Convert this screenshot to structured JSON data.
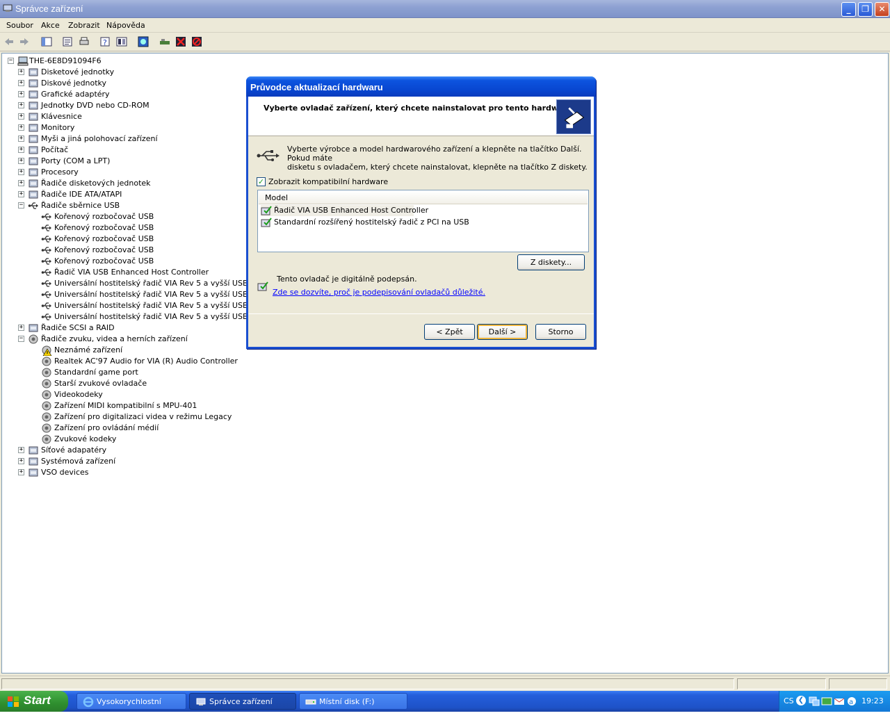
{
  "window": {
    "title": "Správce zařízení"
  },
  "menu": [
    "Soubor",
    "Akce",
    "Zobrazit",
    "Nápověda"
  ],
  "toolbar_icons": [
    "back-icon",
    "forward-icon",
    "show-hide-tree-icon",
    "properties-icon",
    "print-icon",
    "help-icon",
    "view-icon",
    "scan-hardware-icon",
    "update-driver-icon",
    "uninstall-icon",
    "disable-icon"
  ],
  "tree": {
    "root": "THE-6E8D91094F6",
    "items": [
      {
        "label": "Disketové jednotky",
        "icon": "floppy-drive-icon",
        "expander": "+",
        "level": 1
      },
      {
        "label": "Diskové jednotky",
        "icon": "disk-drive-icon",
        "expander": "+",
        "level": 1
      },
      {
        "label": "Grafické adaptéry",
        "icon": "display-adapter-icon",
        "expander": "+",
        "level": 1
      },
      {
        "label": "Jednotky DVD nebo CD-ROM",
        "icon": "cdrom-icon",
        "expander": "+",
        "level": 1
      },
      {
        "label": "Klávesnice",
        "icon": "keyboard-icon",
        "expander": "+",
        "level": 1
      },
      {
        "label": "Monitory",
        "icon": "monitor-icon",
        "expander": "+",
        "level": 1
      },
      {
        "label": "Myši a jiná polohovací zařízení",
        "icon": "mouse-icon",
        "expander": "+",
        "level": 1
      },
      {
        "label": "Počítač",
        "icon": "computer-icon",
        "expander": "+",
        "level": 1
      },
      {
        "label": "Porty (COM a LPT)",
        "icon": "port-icon",
        "expander": "+",
        "level": 1
      },
      {
        "label": "Procesory",
        "icon": "processor-icon",
        "expander": "+",
        "level": 1
      },
      {
        "label": "Řadiče disketových jednotek",
        "icon": "floppy-controller-icon",
        "expander": "+",
        "level": 1
      },
      {
        "label": "Řadiče IDE ATA/ATAPI",
        "icon": "ide-controller-icon",
        "expander": "+",
        "level": 1
      },
      {
        "label": "Řadiče sběrnice USB",
        "icon": "usb-icon",
        "expander": "−",
        "level": 1
      },
      {
        "label": "Kořenový rozbočovač USB",
        "icon": "usb-icon",
        "expander": "",
        "level": 2
      },
      {
        "label": "Kořenový rozbočovač USB",
        "icon": "usb-icon",
        "expander": "",
        "level": 2
      },
      {
        "label": "Kořenový rozbočovač USB",
        "icon": "usb-icon",
        "expander": "",
        "level": 2
      },
      {
        "label": "Kořenový rozbočovač USB",
        "icon": "usb-icon",
        "expander": "",
        "level": 2
      },
      {
        "label": "Kořenový rozbočovač USB",
        "icon": "usb-icon",
        "expander": "",
        "level": 2
      },
      {
        "label": "Řadič VIA USB Enhanced Host Controller",
        "icon": "usb-icon",
        "expander": "",
        "level": 2
      },
      {
        "label": "Universální hostitelský řadič VIA Rev 5 a vyšší USB",
        "icon": "usb-icon",
        "expander": "",
        "level": 2
      },
      {
        "label": "Universální hostitelský řadič VIA Rev 5 a vyšší USB",
        "icon": "usb-icon",
        "expander": "",
        "level": 2
      },
      {
        "label": "Universální hostitelský řadič VIA Rev 5 a vyšší USB",
        "icon": "usb-icon",
        "expander": "",
        "level": 2
      },
      {
        "label": "Universální hostitelský řadič VIA Rev 5 a vyšší USB",
        "icon": "usb-icon",
        "expander": "",
        "level": 2
      },
      {
        "label": "Řadiče SCSI a RAID",
        "icon": "scsi-icon",
        "expander": "+",
        "level": 1
      },
      {
        "label": "Řadiče zvuku, videa a herních zařízení",
        "icon": "sound-icon",
        "expander": "−",
        "level": 1
      },
      {
        "label": "Neznámé zařízení",
        "icon": "warning-device-icon",
        "expander": "",
        "level": 2
      },
      {
        "label": "Realtek AC'97 Audio for VIA (R) Audio Controller",
        "icon": "sound-icon",
        "expander": "",
        "level": 2
      },
      {
        "label": "Standardní game port",
        "icon": "sound-icon",
        "expander": "",
        "level": 2
      },
      {
        "label": "Starší zvukové ovladače",
        "icon": "sound-icon",
        "expander": "",
        "level": 2
      },
      {
        "label": "Videokodeky",
        "icon": "sound-icon",
        "expander": "",
        "level": 2
      },
      {
        "label": "Zařízení MIDI kompatibilní s MPU-401",
        "icon": "sound-icon",
        "expander": "",
        "level": 2
      },
      {
        "label": "Zařízení pro digitalizaci videa v režimu Legacy",
        "icon": "sound-icon",
        "expander": "",
        "level": 2
      },
      {
        "label": "Zařízení pro ovládání médií",
        "icon": "sound-icon",
        "expander": "",
        "level": 2
      },
      {
        "label": "Zvukové kodeky",
        "icon": "sound-icon",
        "expander": "",
        "level": 2
      },
      {
        "label": "Síťové adapatéry",
        "icon": "network-adapter-icon",
        "expander": "+",
        "level": 1
      },
      {
        "label": "Systémová zařízení",
        "icon": "system-device-icon",
        "expander": "+",
        "level": 1
      },
      {
        "label": "VSO devices",
        "icon": "vso-device-icon",
        "expander": "+",
        "level": 1
      }
    ]
  },
  "dialog": {
    "title": "Průvodce aktualizací hardwaru",
    "heading": "Vyberte ovladač zařízení, který chcete nainstalovat pro tento hardware.",
    "instruction_line1": "Vyberte výrobce a model hardwarového zařízení a klepněte na tlačítko Další. Pokud máte",
    "instruction_line2": "disketu s ovladačem, který chcete nainstalovat, klepněte na tlačítko Z diskety.",
    "checkbox_label": "Zobrazit kompatibilní hardware",
    "checkbox_checked": true,
    "list_header": "Model",
    "models": [
      "Řadič VIA USB Enhanced Host Controller",
      "Standardní rozšířený hostitelský řadič z PCI na USB"
    ],
    "from_disk_button": "Z diskety...",
    "signed_text": "Tento ovladač je digitálně podepsán.",
    "signed_link": "Zde se dozvíte, proč je podepisování ovladačů důležité.",
    "back_button": "< Zpět",
    "next_button": "Další >",
    "cancel_button": "Storno"
  },
  "taskbar": {
    "start": "Start",
    "tasks": [
      {
        "label": "Vysokorychlostní host...",
        "icon": "ie-icon",
        "active": false
      },
      {
        "label": "Správce zařízení",
        "icon": "device-manager-icon",
        "active": true
      },
      {
        "label": "Místní disk (F:)",
        "icon": "drive-icon",
        "active": false
      }
    ],
    "language": "CS",
    "clock": "19:23"
  },
  "colors": {
    "title_active": "#0a46d0",
    "title_inactive": "#8ea1d2",
    "taskbar": "#245edb",
    "start": "#2f8f2f",
    "link": "#0000ff"
  }
}
